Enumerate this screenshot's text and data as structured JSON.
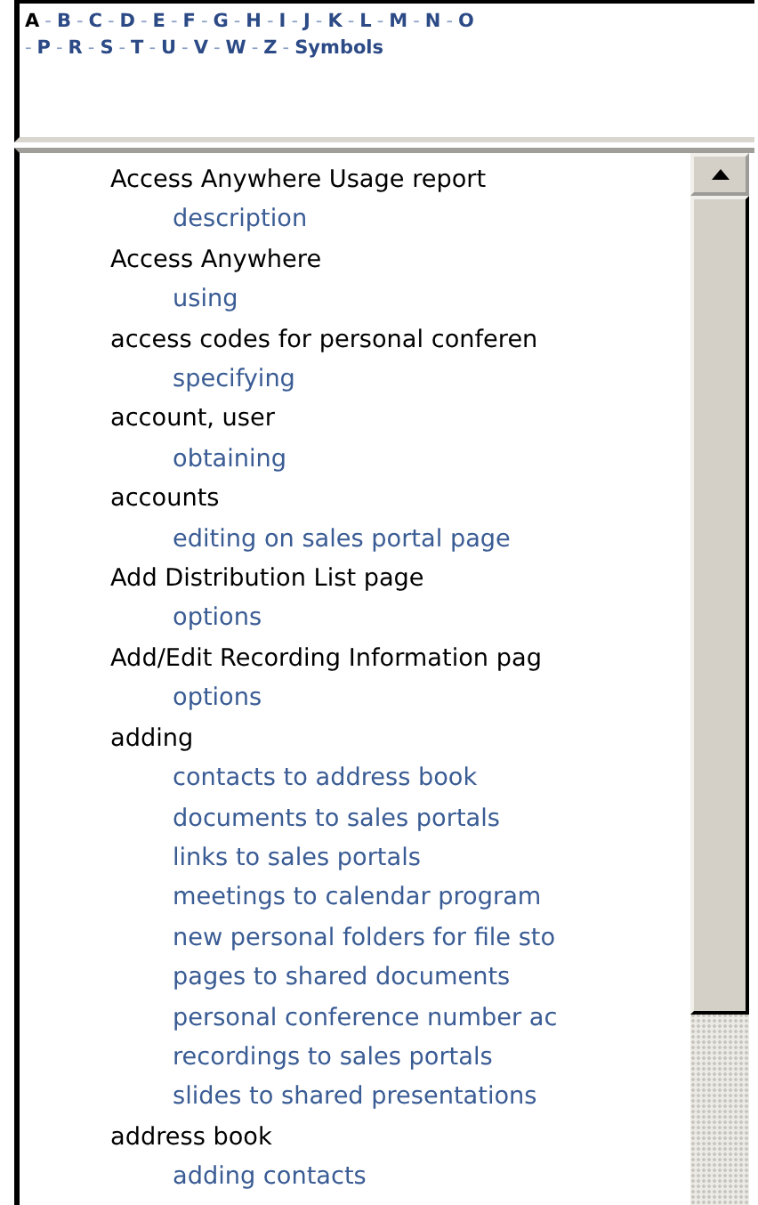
{
  "letter_rows": [
    [
      {
        "kind": "letter",
        "label": "A",
        "selected": true
      },
      {
        "kind": "separator",
        "label": "-"
      },
      {
        "kind": "letter",
        "label": "B",
        "selected": false
      },
      {
        "kind": "separator",
        "label": "-"
      },
      {
        "kind": "letter",
        "label": "C",
        "selected": false
      },
      {
        "kind": "separator",
        "label": "-"
      },
      {
        "kind": "letter",
        "label": "D",
        "selected": false
      },
      {
        "kind": "separator",
        "label": "-"
      },
      {
        "kind": "letter",
        "label": "E",
        "selected": false
      },
      {
        "kind": "separator",
        "label": "-"
      },
      {
        "kind": "letter",
        "label": "F",
        "selected": false
      },
      {
        "kind": "separator",
        "label": "-"
      },
      {
        "kind": "letter",
        "label": "G",
        "selected": false
      },
      {
        "kind": "separator",
        "label": "-"
      },
      {
        "kind": "letter",
        "label": "H",
        "selected": false
      },
      {
        "kind": "separator",
        "label": "-"
      },
      {
        "kind": "letter",
        "label": "I",
        "selected": false
      },
      {
        "kind": "separator",
        "label": "-"
      },
      {
        "kind": "letter",
        "label": "J",
        "selected": false
      },
      {
        "kind": "separator",
        "label": "-"
      },
      {
        "kind": "letter",
        "label": "K",
        "selected": false
      },
      {
        "kind": "separator",
        "label": "-"
      },
      {
        "kind": "letter",
        "label": "L",
        "selected": false
      },
      {
        "kind": "separator",
        "label": "-"
      },
      {
        "kind": "letter",
        "label": "M",
        "selected": false
      },
      {
        "kind": "separator",
        "label": "-"
      },
      {
        "kind": "letter",
        "label": "N",
        "selected": false
      },
      {
        "kind": "separator",
        "label": "-"
      },
      {
        "kind": "letter",
        "label": "O",
        "selected": false
      }
    ],
    [
      {
        "kind": "separator",
        "label": "-"
      },
      {
        "kind": "letter",
        "label": "P",
        "selected": false
      },
      {
        "kind": "separator",
        "label": "-"
      },
      {
        "kind": "letter",
        "label": "R",
        "selected": false
      },
      {
        "kind": "separator",
        "label": "-"
      },
      {
        "kind": "letter",
        "label": "S",
        "selected": false
      },
      {
        "kind": "separator",
        "label": "-"
      },
      {
        "kind": "letter",
        "label": "T",
        "selected": false
      },
      {
        "kind": "separator",
        "label": "-"
      },
      {
        "kind": "letter",
        "label": "U",
        "selected": false
      },
      {
        "kind": "separator",
        "label": "-"
      },
      {
        "kind": "letter",
        "label": "V",
        "selected": false
      },
      {
        "kind": "separator",
        "label": "-"
      },
      {
        "kind": "letter",
        "label": "W",
        "selected": false
      },
      {
        "kind": "separator",
        "label": "-"
      },
      {
        "kind": "letter",
        "label": "Z",
        "selected": false
      },
      {
        "kind": "separator",
        "label": "-"
      },
      {
        "kind": "letter",
        "label": "Symbols",
        "selected": false
      }
    ]
  ],
  "entries": [
    {
      "label": "Access Anywhere Usage report",
      "children": [
        {
          "label": "description"
        }
      ]
    },
    {
      "label": "Access Anywhere",
      "children": [
        {
          "label": "using"
        }
      ]
    },
    {
      "label": "access codes for personal conferen",
      "children": [
        {
          "label": "specifying"
        }
      ]
    },
    {
      "label": "account, user",
      "children": [
        {
          "label": "obtaining"
        }
      ]
    },
    {
      "label": "accounts",
      "children": [
        {
          "label": "editing on sales portal page"
        }
      ]
    },
    {
      "label": "Add Distribution List page",
      "children": [
        {
          "label": "options"
        }
      ]
    },
    {
      "label": "Add/Edit Recording Information pag",
      "children": [
        {
          "label": "options"
        }
      ]
    },
    {
      "label": "adding",
      "children": [
        {
          "label": "contacts to address book"
        },
        {
          "label": "documents to sales portals"
        },
        {
          "label": "links to sales portals"
        },
        {
          "label": "meetings to calendar program"
        },
        {
          "label": "new personal folders for file sto"
        },
        {
          "label": "pages to shared documents"
        },
        {
          "label": "personal conference number ac"
        },
        {
          "label": "recordings to sales portals"
        },
        {
          "label": "slides to shared presentations"
        }
      ]
    },
    {
      "label": "address book",
      "children": [
        {
          "label": "adding contacts"
        }
      ]
    }
  ]
}
